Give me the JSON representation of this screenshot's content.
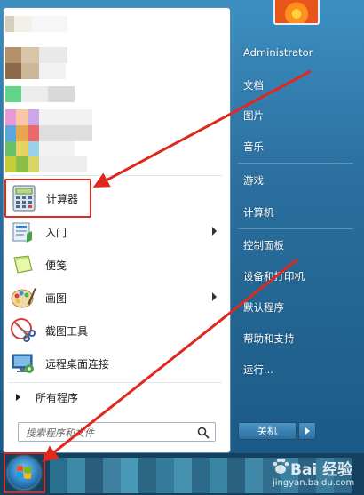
{
  "left_panel": {
    "items": [
      {
        "label": "计算器",
        "icon": "calculator-icon",
        "has_submenu": false
      },
      {
        "label": "入门",
        "icon": "getting-started-icon",
        "has_submenu": true
      },
      {
        "label": "便笺",
        "icon": "sticky-notes-icon",
        "has_submenu": false
      },
      {
        "label": "画图",
        "icon": "paint-palette-icon",
        "has_submenu": true
      },
      {
        "label": "截图工具",
        "icon": "scissors-icon",
        "has_submenu": false
      },
      {
        "label": "远程桌面连接",
        "icon": "remote-desktop-icon",
        "has_submenu": false
      }
    ],
    "all_programs_label": "所有程序",
    "search_placeholder": "搜索程序和文件"
  },
  "right_panel": {
    "user": "Administrator",
    "items": [
      "文档",
      "图片",
      "音乐",
      "游戏",
      "计算机",
      "控制面板",
      "设备和打印机",
      "默认程序",
      "帮助和支持",
      "运行..."
    ]
  },
  "shutdown": {
    "label": "关机"
  },
  "watermark": {
    "main": "Bai 经验",
    "sub": "jingyan.baidu.com"
  },
  "colors": {
    "highlight_box": "#e0281f",
    "accent": "#2a6f9e"
  }
}
